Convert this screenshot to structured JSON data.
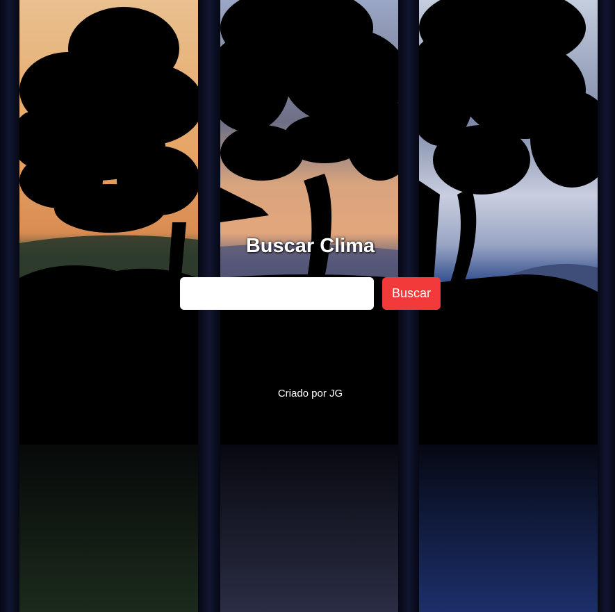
{
  "page": {
    "title": "Buscar Clima",
    "search": {
      "value": "",
      "placeholder": "",
      "button_label": "Buscar"
    },
    "footer": "Criado por JG"
  },
  "colors": {
    "button": "#f23a3a",
    "frame": "#0b0e20",
    "text": "#ffffff"
  },
  "background": {
    "panels": [
      "sunset-tree-panel",
      "dusk-tree-panel",
      "evening-tree-panel"
    ]
  }
}
